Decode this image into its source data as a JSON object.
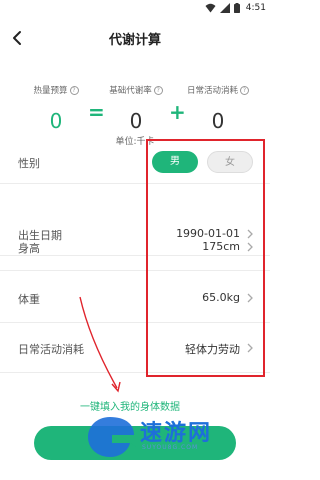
{
  "status": {
    "time": "4:51",
    "icons": [
      "wifi-icon",
      "signal-icon",
      "battery-icon"
    ]
  },
  "header": {
    "title": "代谢计算",
    "back_icon": "chevron-left-icon"
  },
  "formula": {
    "budget": {
      "label": "热量预算",
      "value": "0"
    },
    "bmr": {
      "label": "基础代谢率",
      "value": "0"
    },
    "activity": {
      "label": "日常活动消耗",
      "value": "0"
    },
    "equals": "=",
    "plus": "+",
    "help_icon": "?",
    "unit": "单位:千卡"
  },
  "form": {
    "gender": {
      "label": "性别",
      "male": "男",
      "female": "女",
      "selected": "男"
    },
    "birth": {
      "label": "出生日期",
      "value": "1990-01-01"
    },
    "height": {
      "label": "身高",
      "value": "175cm"
    },
    "weight": {
      "label": "体重",
      "value": "65.0kg"
    },
    "activity": {
      "label": "日常活动消耗",
      "value": "轻体力劳动"
    }
  },
  "annotation": {
    "fill_link": "一键填入我的身体数据"
  },
  "watermark": {
    "text": "速游网",
    "sub": "SUYOU8G.COM"
  },
  "colors": {
    "accent": "#1fb57a",
    "annotation": "#e0242c",
    "watermark": "#1e6fd9"
  }
}
